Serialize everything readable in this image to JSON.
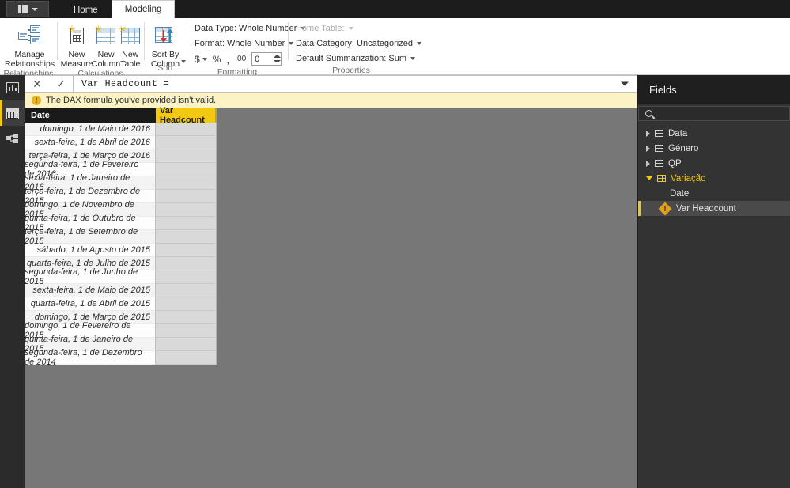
{
  "titlebar": {
    "file_menu_label": "file-menu",
    "tabs": [
      {
        "label": "Home",
        "active": false
      },
      {
        "label": "Modeling",
        "active": true
      }
    ]
  },
  "ribbon": {
    "groups": [
      {
        "name": "Relationships",
        "label": "Relationships",
        "buttons": [
          {
            "label": "Manage\nRelationships",
            "icon": "manage-relationships-icon"
          }
        ]
      },
      {
        "name": "Calculations",
        "label": "Calculations",
        "buttons": [
          {
            "label": "New\nMeasure",
            "icon": "new-measure-icon"
          },
          {
            "label": "New\nColumn",
            "icon": "new-column-icon"
          },
          {
            "label": "New\nTable",
            "icon": "new-table-icon"
          }
        ]
      },
      {
        "name": "Sort",
        "label": "Sort",
        "buttons": [
          {
            "label": "Sort By\nColumn",
            "icon": "sort-by-column-icon"
          }
        ]
      }
    ],
    "formatting": {
      "label": "Formatting",
      "data_type_label": "Data Type: Whole Number",
      "format_label": "Format: Whole Number",
      "currency_icon": "currency-icon",
      "percent_icon": "percent-icon",
      "thousands_icon": "thousands-separator-icon",
      "decimal_icon": "decimal-places-icon",
      "decimal_value": "0"
    },
    "properties": {
      "label": "Properties",
      "home_table_label": "Home Table:",
      "data_category_label": "Data Category: Uncategorized",
      "default_summarization_label": "Default Summarization: Sum"
    }
  },
  "leftnav": {
    "items": [
      {
        "name": "report-view",
        "icon": "report-view-icon",
        "selected": false
      },
      {
        "name": "data-view",
        "icon": "data-view-icon",
        "selected": true
      },
      {
        "name": "model-view",
        "icon": "model-view-icon",
        "selected": false
      }
    ]
  },
  "formula_bar": {
    "cancel_icon": "close-icon",
    "accept_icon": "check-icon",
    "text": "Var Headcount =",
    "expand_icon": "chevron-down-icon",
    "error_icon": "warning-icon",
    "error_message": "The DAX formula you've provided isn't valid."
  },
  "grid": {
    "columns": [
      {
        "key": "date",
        "label": "Date"
      },
      {
        "key": "var_headcount",
        "label": "Var Headcount"
      }
    ],
    "rows": [
      {
        "date": "domingo, 1 de Maio de 2016",
        "var_headcount": ""
      },
      {
        "date": "sexta-feira, 1 de Abril de 2016",
        "var_headcount": ""
      },
      {
        "date": "terça-feira, 1 de Março de 2016",
        "var_headcount": ""
      },
      {
        "date": "segunda-feira, 1 de Fevereiro de 2016",
        "var_headcount": ""
      },
      {
        "date": "sexta-feira, 1 de Janeiro de 2016",
        "var_headcount": ""
      },
      {
        "date": "terça-feira, 1 de Dezembro de 2015",
        "var_headcount": ""
      },
      {
        "date": "domingo, 1 de Novembro de 2015",
        "var_headcount": ""
      },
      {
        "date": "quinta-feira, 1 de Outubro de 2015",
        "var_headcount": ""
      },
      {
        "date": "terça-feira, 1 de Setembro de 2015",
        "var_headcount": ""
      },
      {
        "date": "sábado, 1 de Agosto de 2015",
        "var_headcount": ""
      },
      {
        "date": "quarta-feira, 1 de Julho de 2015",
        "var_headcount": ""
      },
      {
        "date": "segunda-feira, 1 de Junho de 2015",
        "var_headcount": ""
      },
      {
        "date": "sexta-feira, 1 de Maio de 2015",
        "var_headcount": ""
      },
      {
        "date": "quarta-feira, 1 de Abril de 2015",
        "var_headcount": ""
      },
      {
        "date": "domingo, 1 de Março de 2015",
        "var_headcount": ""
      },
      {
        "date": "domingo, 1 de Fevereiro de 2015",
        "var_headcount": ""
      },
      {
        "date": "quinta-feira, 1 de Janeiro de 2015",
        "var_headcount": ""
      },
      {
        "date": "segunda-feira, 1 de Dezembro de 2014",
        "var_headcount": ""
      }
    ]
  },
  "fields": {
    "title": "Fields",
    "search_icon": "search-icon",
    "search_value": "",
    "tree": [
      {
        "label": "Data",
        "type": "table",
        "expanded": false,
        "selected": false
      },
      {
        "label": "Género",
        "type": "table",
        "expanded": false,
        "selected": false
      },
      {
        "label": "QP",
        "type": "table",
        "expanded": false,
        "selected": false
      },
      {
        "label": "Variação",
        "type": "table",
        "expanded": true,
        "selected": false
      },
      {
        "label": "Date",
        "type": "field",
        "expanded": false,
        "selected": false
      },
      {
        "label": "Var Headcount",
        "type": "field-error",
        "expanded": false,
        "selected": true
      }
    ]
  },
  "colors": {
    "accent_gold": "#F2C811",
    "canvas_gray": "#777777",
    "panel_dark": "#333333",
    "error_yellow": "#FBF3C6"
  }
}
